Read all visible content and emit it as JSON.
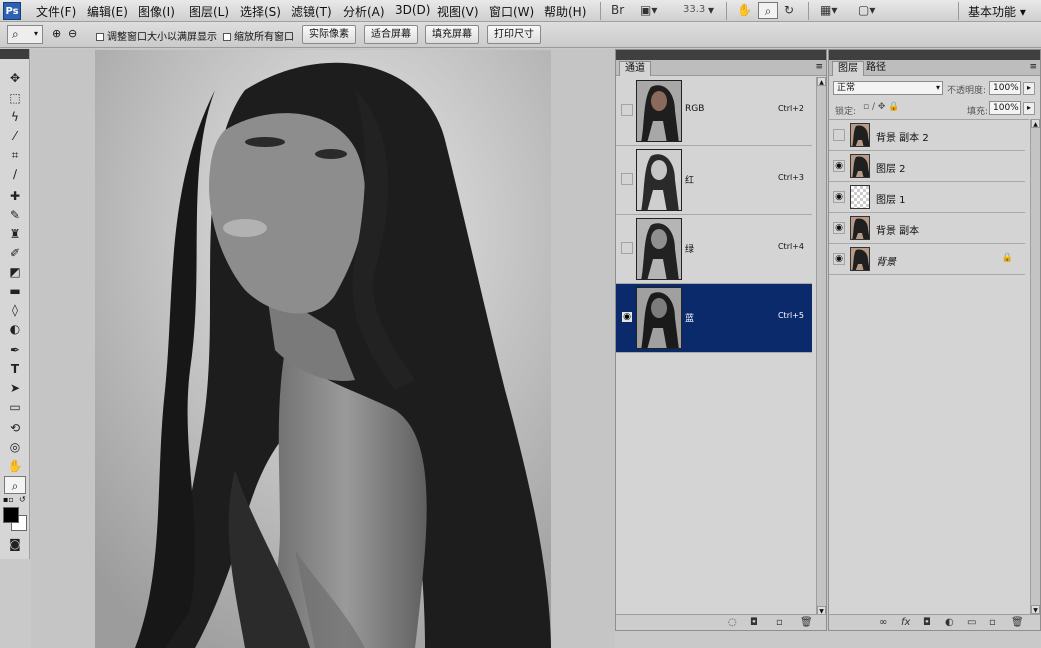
{
  "menubar": {
    "logo": "Ps",
    "items": [
      "文件(F)",
      "编辑(E)",
      "图像(I)",
      "图层(L)",
      "选择(S)",
      "滤镜(T)",
      "分析(A)",
      "3D(D)",
      "视图(V)",
      "窗口(W)",
      "帮助(H)"
    ],
    "zoom": "33.3",
    "workspace": "基本功能"
  },
  "options": {
    "check_resize": "调整窗口大小以满屏显示",
    "check_zoom_all": "缩放所有窗口",
    "btn_actual": "实际像素",
    "btn_fit": "适合屏幕",
    "btn_fill": "填充屏幕",
    "btn_print": "打印尺寸"
  },
  "channels": {
    "tab": "通道",
    "rows": [
      {
        "name": "RGB",
        "shortcut": "Ctrl+2"
      },
      {
        "name": "红",
        "shortcut": "Ctrl+3"
      },
      {
        "name": "绿",
        "shortcut": "Ctrl+4"
      },
      {
        "name": "蓝",
        "shortcut": "Ctrl+5"
      }
    ]
  },
  "layers": {
    "tab_layers": "图层",
    "tab_paths": "路径",
    "blend_mode": "正常",
    "opacity_label": "不透明度:",
    "opacity_value": "100%",
    "lock_label": "锁定:",
    "fill_label": "填充:",
    "fill_value": "100%",
    "rows": [
      {
        "name": "背景 副本 2"
      },
      {
        "name": "图层 2"
      },
      {
        "name": "图层 1"
      },
      {
        "name": "背景 副本"
      },
      {
        "name": "背景"
      }
    ]
  },
  "colors": {
    "selection": "#0b2a6c",
    "panel_header": "#3f3f3f",
    "logo_blue": "#2d62b3"
  }
}
